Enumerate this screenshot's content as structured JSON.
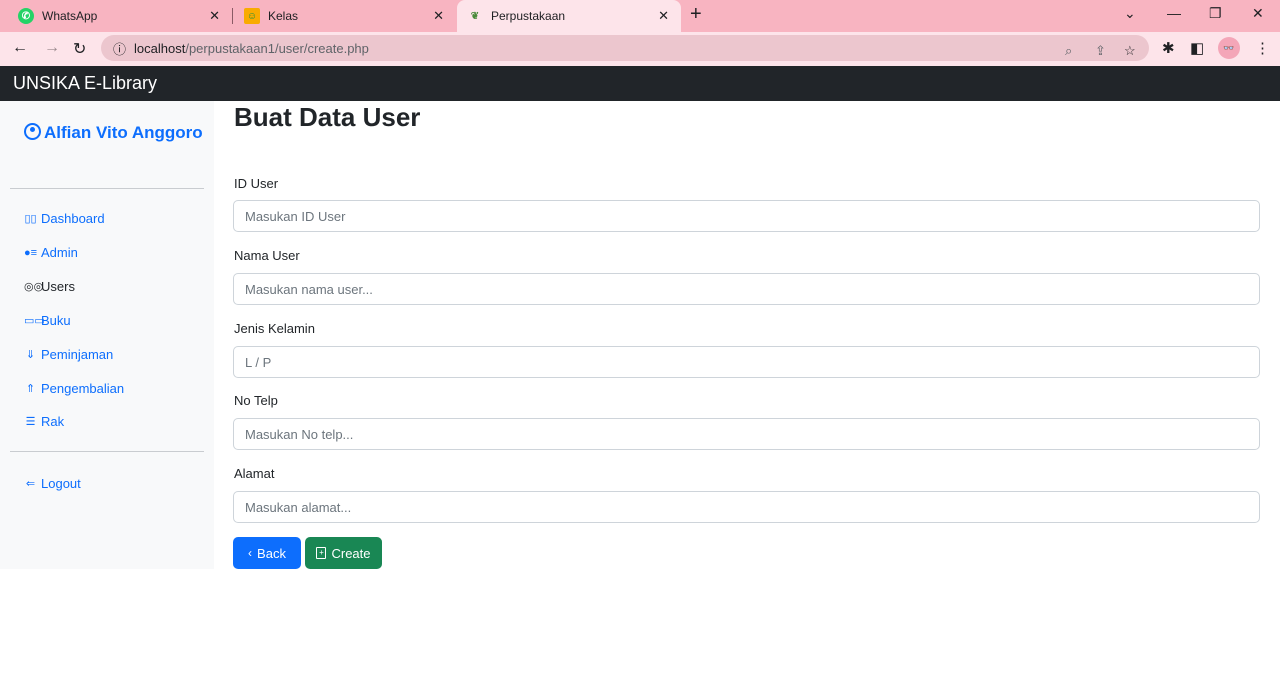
{
  "browser": {
    "tabs": [
      {
        "title": "WhatsApp",
        "icon": "whatsapp-icon"
      },
      {
        "title": "Kelas",
        "icon": "classroom-icon"
      },
      {
        "title": "Perpustakaan",
        "icon": "library-icon"
      }
    ],
    "url_host": "localhost",
    "url_path": "/perpustakaan1/user/create.php"
  },
  "app": {
    "brand": "UNSIKA E-Library"
  },
  "sidebar": {
    "user_name": "Alfian Vito Anggoro",
    "items": [
      {
        "label": "Dashboard",
        "icon": "dashboard-icon"
      },
      {
        "label": "Admin",
        "icon": "admin-icon"
      },
      {
        "label": "Users",
        "icon": "users-icon"
      },
      {
        "label": "Buku",
        "icon": "book-icon"
      },
      {
        "label": "Peminjaman",
        "icon": "borrow-icon"
      },
      {
        "label": "Pengembalian",
        "icon": "return-icon"
      },
      {
        "label": "Rak",
        "icon": "shelf-icon"
      }
    ],
    "logout": "Logout"
  },
  "form": {
    "title": "Buat Data User",
    "fields": [
      {
        "label": "ID User",
        "placeholder": "Masukan ID User",
        "value": ""
      },
      {
        "label": "Nama User",
        "placeholder": "Masukan nama user...",
        "value": ""
      },
      {
        "label": "Jenis Kelamin",
        "placeholder": "L / P",
        "value": ""
      },
      {
        "label": "No Telp",
        "placeholder": "Masukan No telp...",
        "value": ""
      },
      {
        "label": "Alamat",
        "placeholder": "Masukan alamat...",
        "value": ""
      }
    ],
    "back_label": "Back",
    "create_label": "Create"
  },
  "colors": {
    "primary": "#0d6efd",
    "success": "#198754",
    "navbar": "#212529",
    "sidebar_bg": "#f8f9fa",
    "tabbar": "#f8b4c1"
  }
}
